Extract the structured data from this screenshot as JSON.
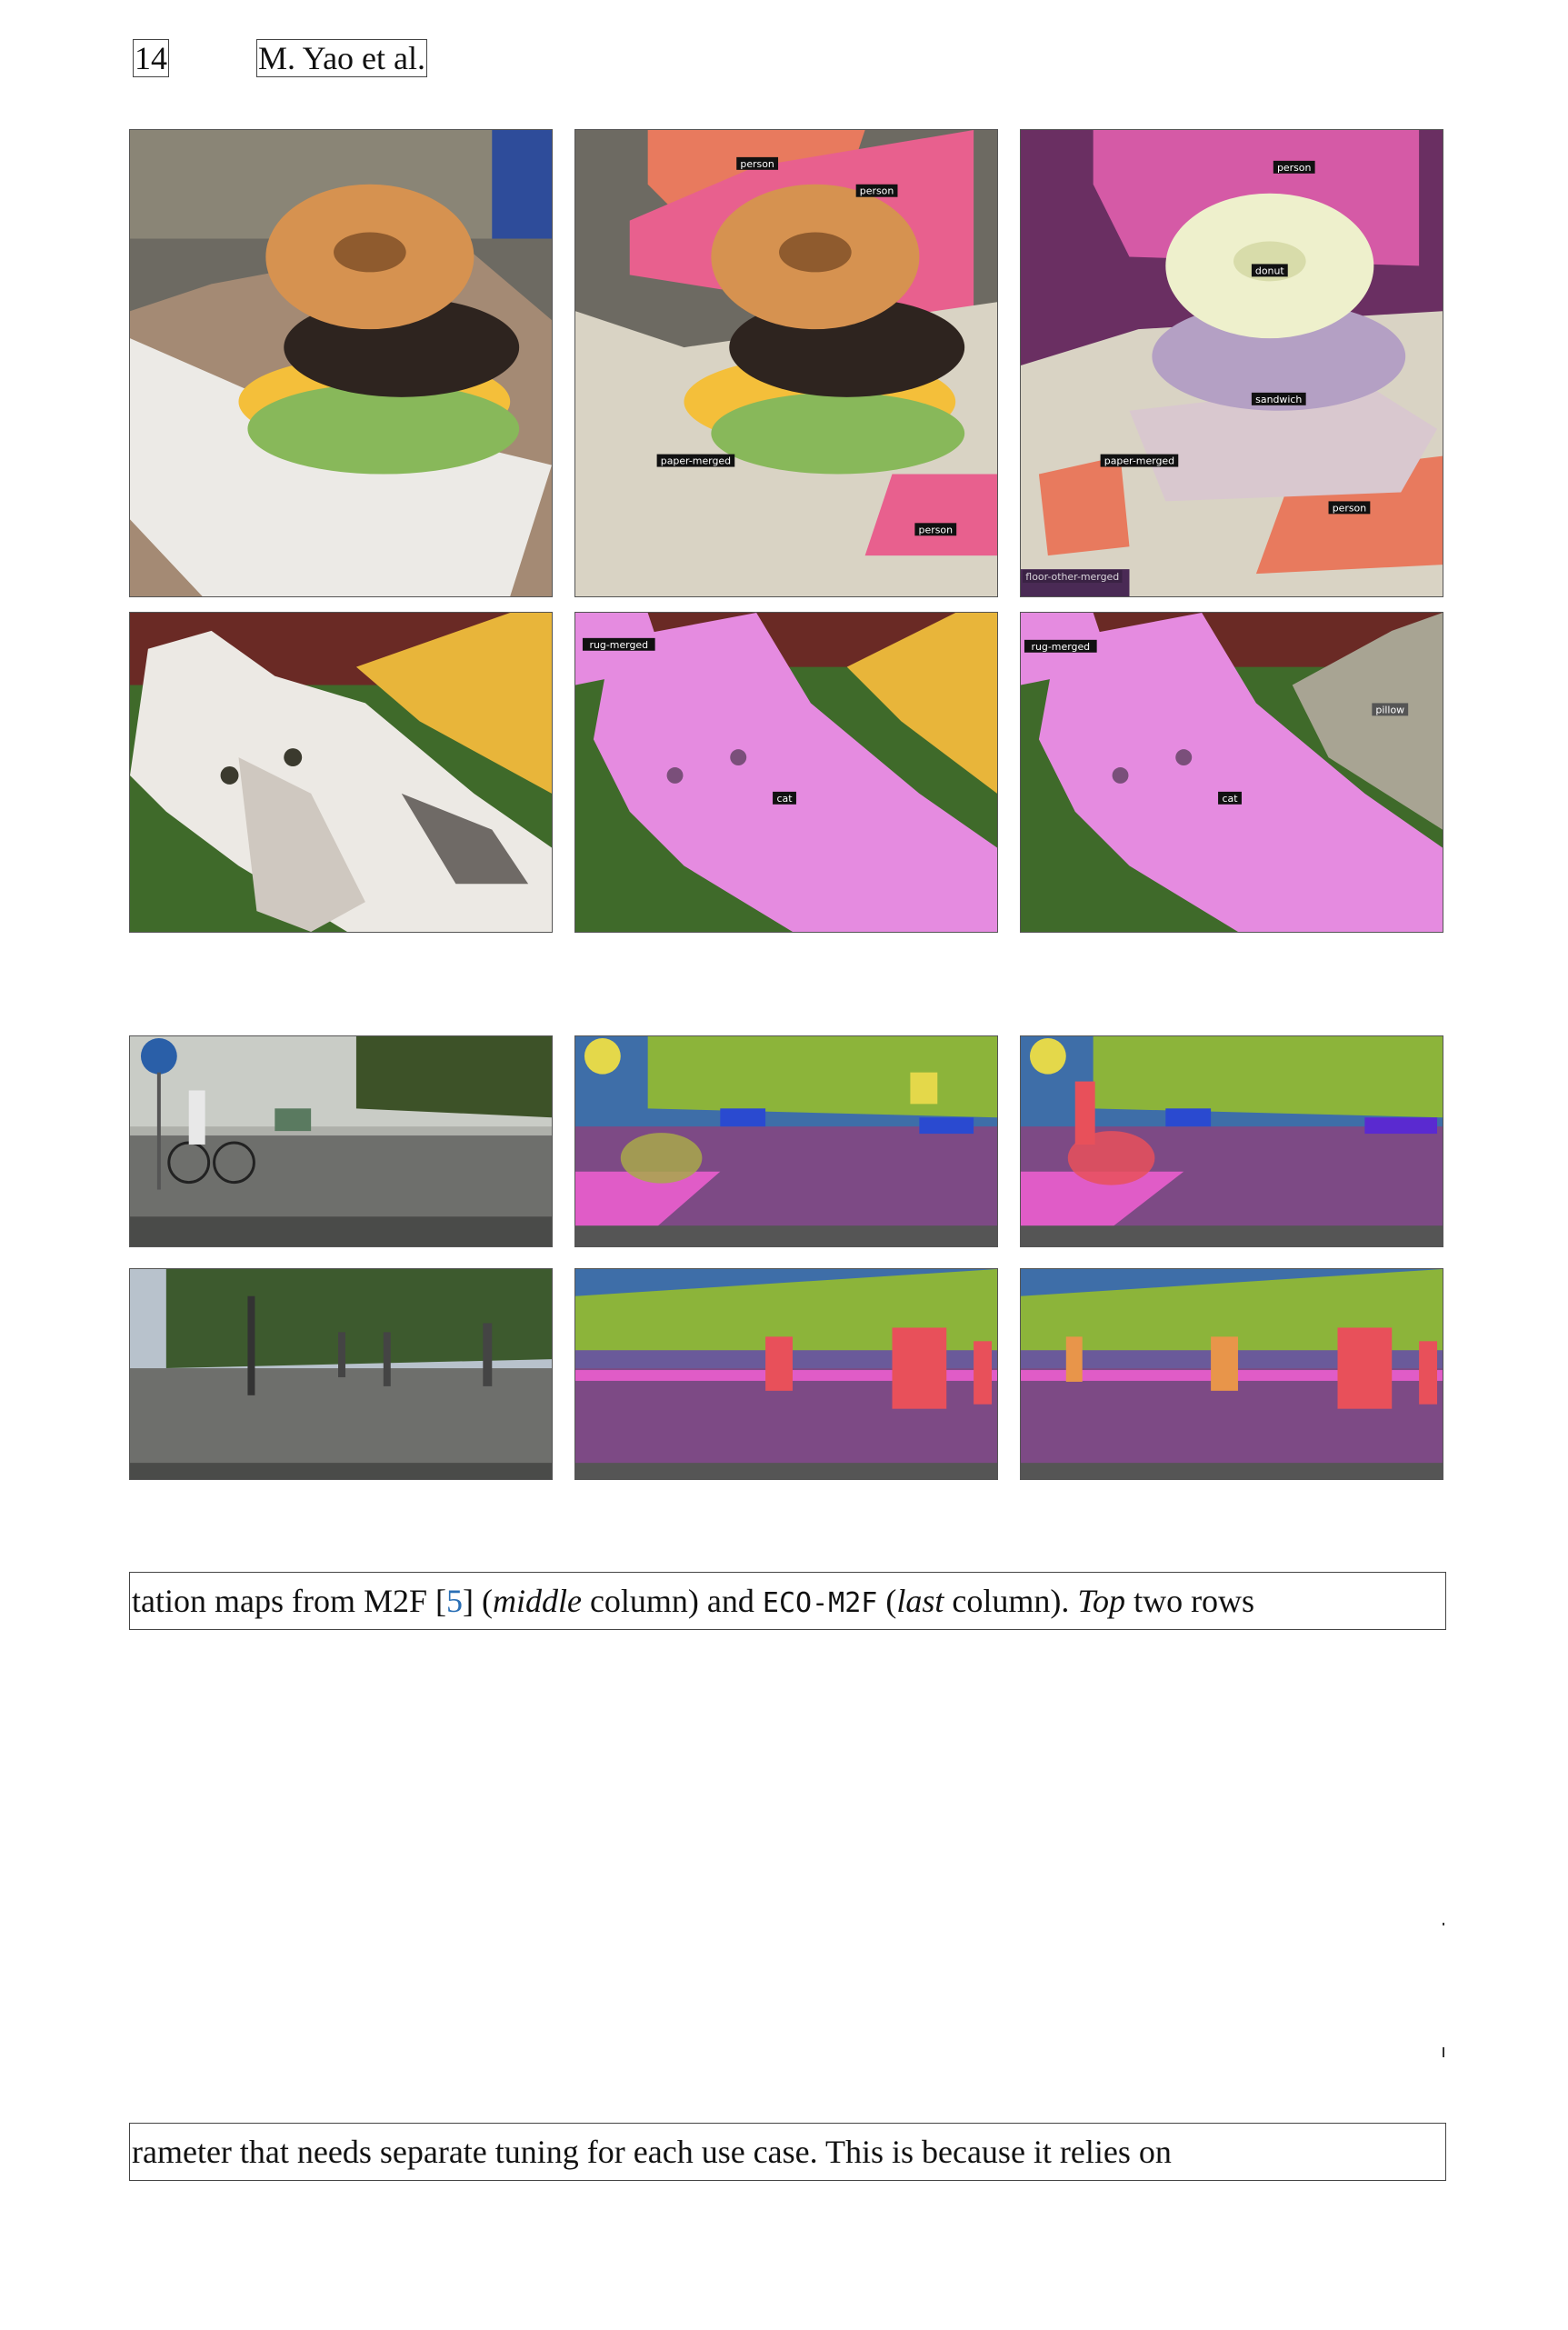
{
  "header": {
    "page_number": "14",
    "running_title": "M. Yao et al."
  },
  "figure": {
    "coco_row1": {
      "middle_labels": [
        "person",
        "person",
        "paper-merged",
        "person"
      ],
      "last_labels": [
        "person",
        "donut",
        "sandwich",
        "paper-merged",
        "person",
        "floor-other-merged"
      ]
    },
    "coco_row2": {
      "middle_labels": [
        "rug-merged",
        "cat"
      ],
      "last_labels": [
        "rug-merged",
        "pillow",
        "cat"
      ]
    }
  },
  "caption": {
    "line1": {
      "pre": "tation maps from M2F [",
      "ref": "5",
      "mid1": "] (",
      "italic1": "middle",
      "mid2": " column) and ",
      "mono": "ECO-M2F",
      "mid3": " (",
      "italic2": "last",
      "mid4": " column). ",
      "italic3": "Top",
      "post": " two rows"
    },
    "line2": "rameter that needs separate tuning for each use case. This is because it relies on"
  },
  "colors": {
    "person_mask": "#e8608e",
    "paper_mask": "#d9d3c4",
    "donut_mask": "#eef0cc",
    "cat_mask": "#e58be0",
    "road_mask": "#7d4a85",
    "vegetation_mask": "#8cb43a",
    "pedestrian_mask": "#e8505a",
    "link": "#2a6fb5"
  }
}
